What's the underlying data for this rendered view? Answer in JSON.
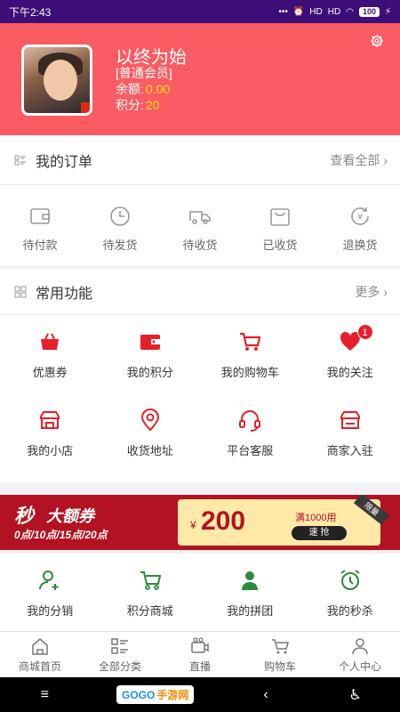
{
  "status": {
    "time": "下午2:43",
    "signal1": "HD",
    "signal2": "HD",
    "battery": "100"
  },
  "profile": {
    "name": "以终为始",
    "level": "[普通会员]",
    "balance_label": "余额:",
    "balance_value": "0.00",
    "points_label": "积分:",
    "points_value": "20"
  },
  "orders": {
    "title": "我的订单",
    "more": "查看全部",
    "items": [
      {
        "label": "待付款",
        "icon": "wallet-icon"
      },
      {
        "label": "待发货",
        "icon": "clock-icon"
      },
      {
        "label": "待收货",
        "icon": "truck-icon"
      },
      {
        "label": "已收货",
        "icon": "bag-icon"
      },
      {
        "label": "退换货",
        "icon": "refund-icon"
      }
    ]
  },
  "functions": {
    "title": "常用功能",
    "more": "更多",
    "items": [
      {
        "label": "优惠券",
        "icon": "basket-icon"
      },
      {
        "label": "我的积分",
        "icon": "wallet-icon"
      },
      {
        "label": "我的购物车",
        "icon": "cart-icon"
      },
      {
        "label": "我的关注",
        "icon": "heart-icon",
        "badge": "1"
      },
      {
        "label": "我的小店",
        "icon": "shop-icon"
      },
      {
        "label": "收货地址",
        "icon": "location-icon"
      },
      {
        "label": "平台客服",
        "icon": "headset-icon"
      },
      {
        "label": "商家入驻",
        "icon": "store-icon"
      }
    ]
  },
  "banner": {
    "miao": "秒",
    "title": "大额券",
    "times": "0点/10点/15点/20点",
    "yen": "¥",
    "amount": "200",
    "condition": "满1000用",
    "grab": "速 抢",
    "tag": "限量"
  },
  "extras": {
    "items": [
      {
        "label": "我的分销",
        "icon": "user-add-icon"
      },
      {
        "label": "积分商城",
        "icon": "cart-icon"
      },
      {
        "label": "我的拼团",
        "icon": "group-icon"
      },
      {
        "label": "我的秒杀",
        "icon": "alarm-icon"
      }
    ]
  },
  "tabs": [
    {
      "label": "商城首页",
      "icon": "home-icon"
    },
    {
      "label": "全部分类",
      "icon": "category-icon"
    },
    {
      "label": "直播",
      "icon": "video-icon"
    },
    {
      "label": "购物车",
      "icon": "cart-icon"
    },
    {
      "label": "个人中心",
      "icon": "person-icon"
    }
  ],
  "navbar": {
    "logo_a": "GOGO",
    "logo_b": "手游网"
  },
  "colors": {
    "brand": "#fb5b62",
    "accent_red": "#e6202a",
    "green": "#2b8a3e",
    "status_bar": "#3d0e78"
  }
}
